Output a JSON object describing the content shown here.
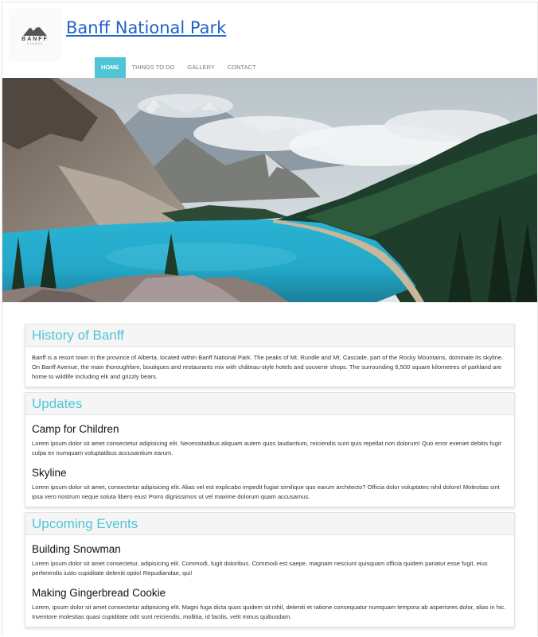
{
  "site": {
    "title": "Banff National Park",
    "logo": {
      "text": "BANFF",
      "subtext": "CANADA"
    }
  },
  "nav": {
    "items": [
      {
        "label": "Home",
        "active": true
      },
      {
        "label": "Things to do",
        "active": false
      },
      {
        "label": "Gallery",
        "active": false
      },
      {
        "label": "Contact",
        "active": false
      }
    ]
  },
  "history": {
    "title": "History of Banff",
    "body": "Banff is a resort town in the province of Alberta, located within Banff National Park. The peaks of Mt. Rundle and Mt. Cascade, part of the Rocky Mountains, dominate its skyline. On Banff Avenue, the main thoroughfare, boutiques and restaurants mix with château-style hotels and souvenir shops. The surrounding 6,500 square kilometres of parkland are home to wildlife including elk and grizzly bears."
  },
  "updates": {
    "title": "Updates",
    "items": [
      {
        "heading": "Camp for Children",
        "text": "Lorem ipsum dolor sit amet consectetur adipisicing elit. Necessitatibus aliquam autem quos laudantium, reiciendis sunt quis repellat non dolorum! Quo error eveniet debitis fugit culpa ex numquam voluptatibus accusantium earum."
      },
      {
        "heading": "Skyline",
        "text": "Lorem ipsum dolor sit amet, consectetur adipisicing elit. Alias vel est explicabo impedit fugiat similique quo earum architecto? Officia dolor voluptates nihil dolore! Molestias sint ipsa vero nostrum neque soluta libero eius! Porro dignissimos ut vel maxime dolorum quam accusamus."
      }
    ]
  },
  "events": {
    "title": "Upcoming Events",
    "items": [
      {
        "heading": "Building Snowman",
        "text": "Lorem ipsum dolor sit amet consectetur, adipisicing elit. Commodi, fugit doloribus. Commodi est saepe, magnam nesciunt quisquam officia quidem pariatur esse fugit, eius perferendis iusto cupiditate deleniti optio! Repudiandae, qui!"
      },
      {
        "heading": "Making Gingerbread Cookie",
        "text": "Lorem, ipsum dolor sit amet consectetur adipisicing elit. Magni fuga dicta quos quidem sit nihil, deleniti et ratione consequatur numquam tempora ab asperiores dolor, alias in hic. Inventore molestias quasi cupiditate odit sunt reiciendis, mollitia, id facilis, velit minus quibusdam."
      }
    ]
  },
  "colors": {
    "accent": "#4fc5d6",
    "link": "#1f62c8"
  }
}
